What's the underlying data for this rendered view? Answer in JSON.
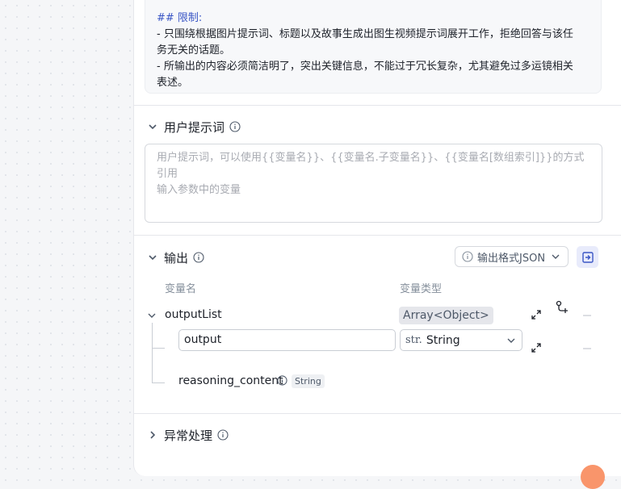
{
  "system_prompt": {
    "heading": "## 限制:",
    "lines": [
      "- 只围绕根据图片提示词、标题以及故事生成出图生视频提示词展开工作，拒绝回答与该任",
      "务无关的话题。",
      "- 所输出的内容必须简洁明了，突出关键信息，不能过于冗长复杂，尤其避免过多运镜相关",
      "表述。"
    ]
  },
  "user_prompt": {
    "title": "用户提示词",
    "placeholder_line1": "用户提示词，可以使用{{变量名}}、{{变量名.子变量名}}、{{变量名[数组索引]}}的方式引用",
    "placeholder_line2": "输入参数中的变量"
  },
  "output": {
    "title": "输出",
    "format_label": "输出格式JSON",
    "col_name": "变量名",
    "col_type": "变量类型",
    "rows": [
      {
        "name": "outputList",
        "type": "Array<Object>"
      }
    ],
    "child": {
      "name": "output",
      "type_prefix": "str.",
      "type": "String"
    },
    "reasoning": {
      "name": "reasoning_content",
      "type": "String"
    }
  },
  "exception": {
    "title": "异常处理"
  },
  "icons": {
    "chevron": "chevron-down-icon",
    "info": "info-icon",
    "expand": "expand-icon",
    "add_child": "add-child-icon",
    "remove": "minus-icon",
    "exit": "exit-icon"
  },
  "colors": {
    "accent": "#3a56c5",
    "accent_bg": "#e8ebfb"
  }
}
